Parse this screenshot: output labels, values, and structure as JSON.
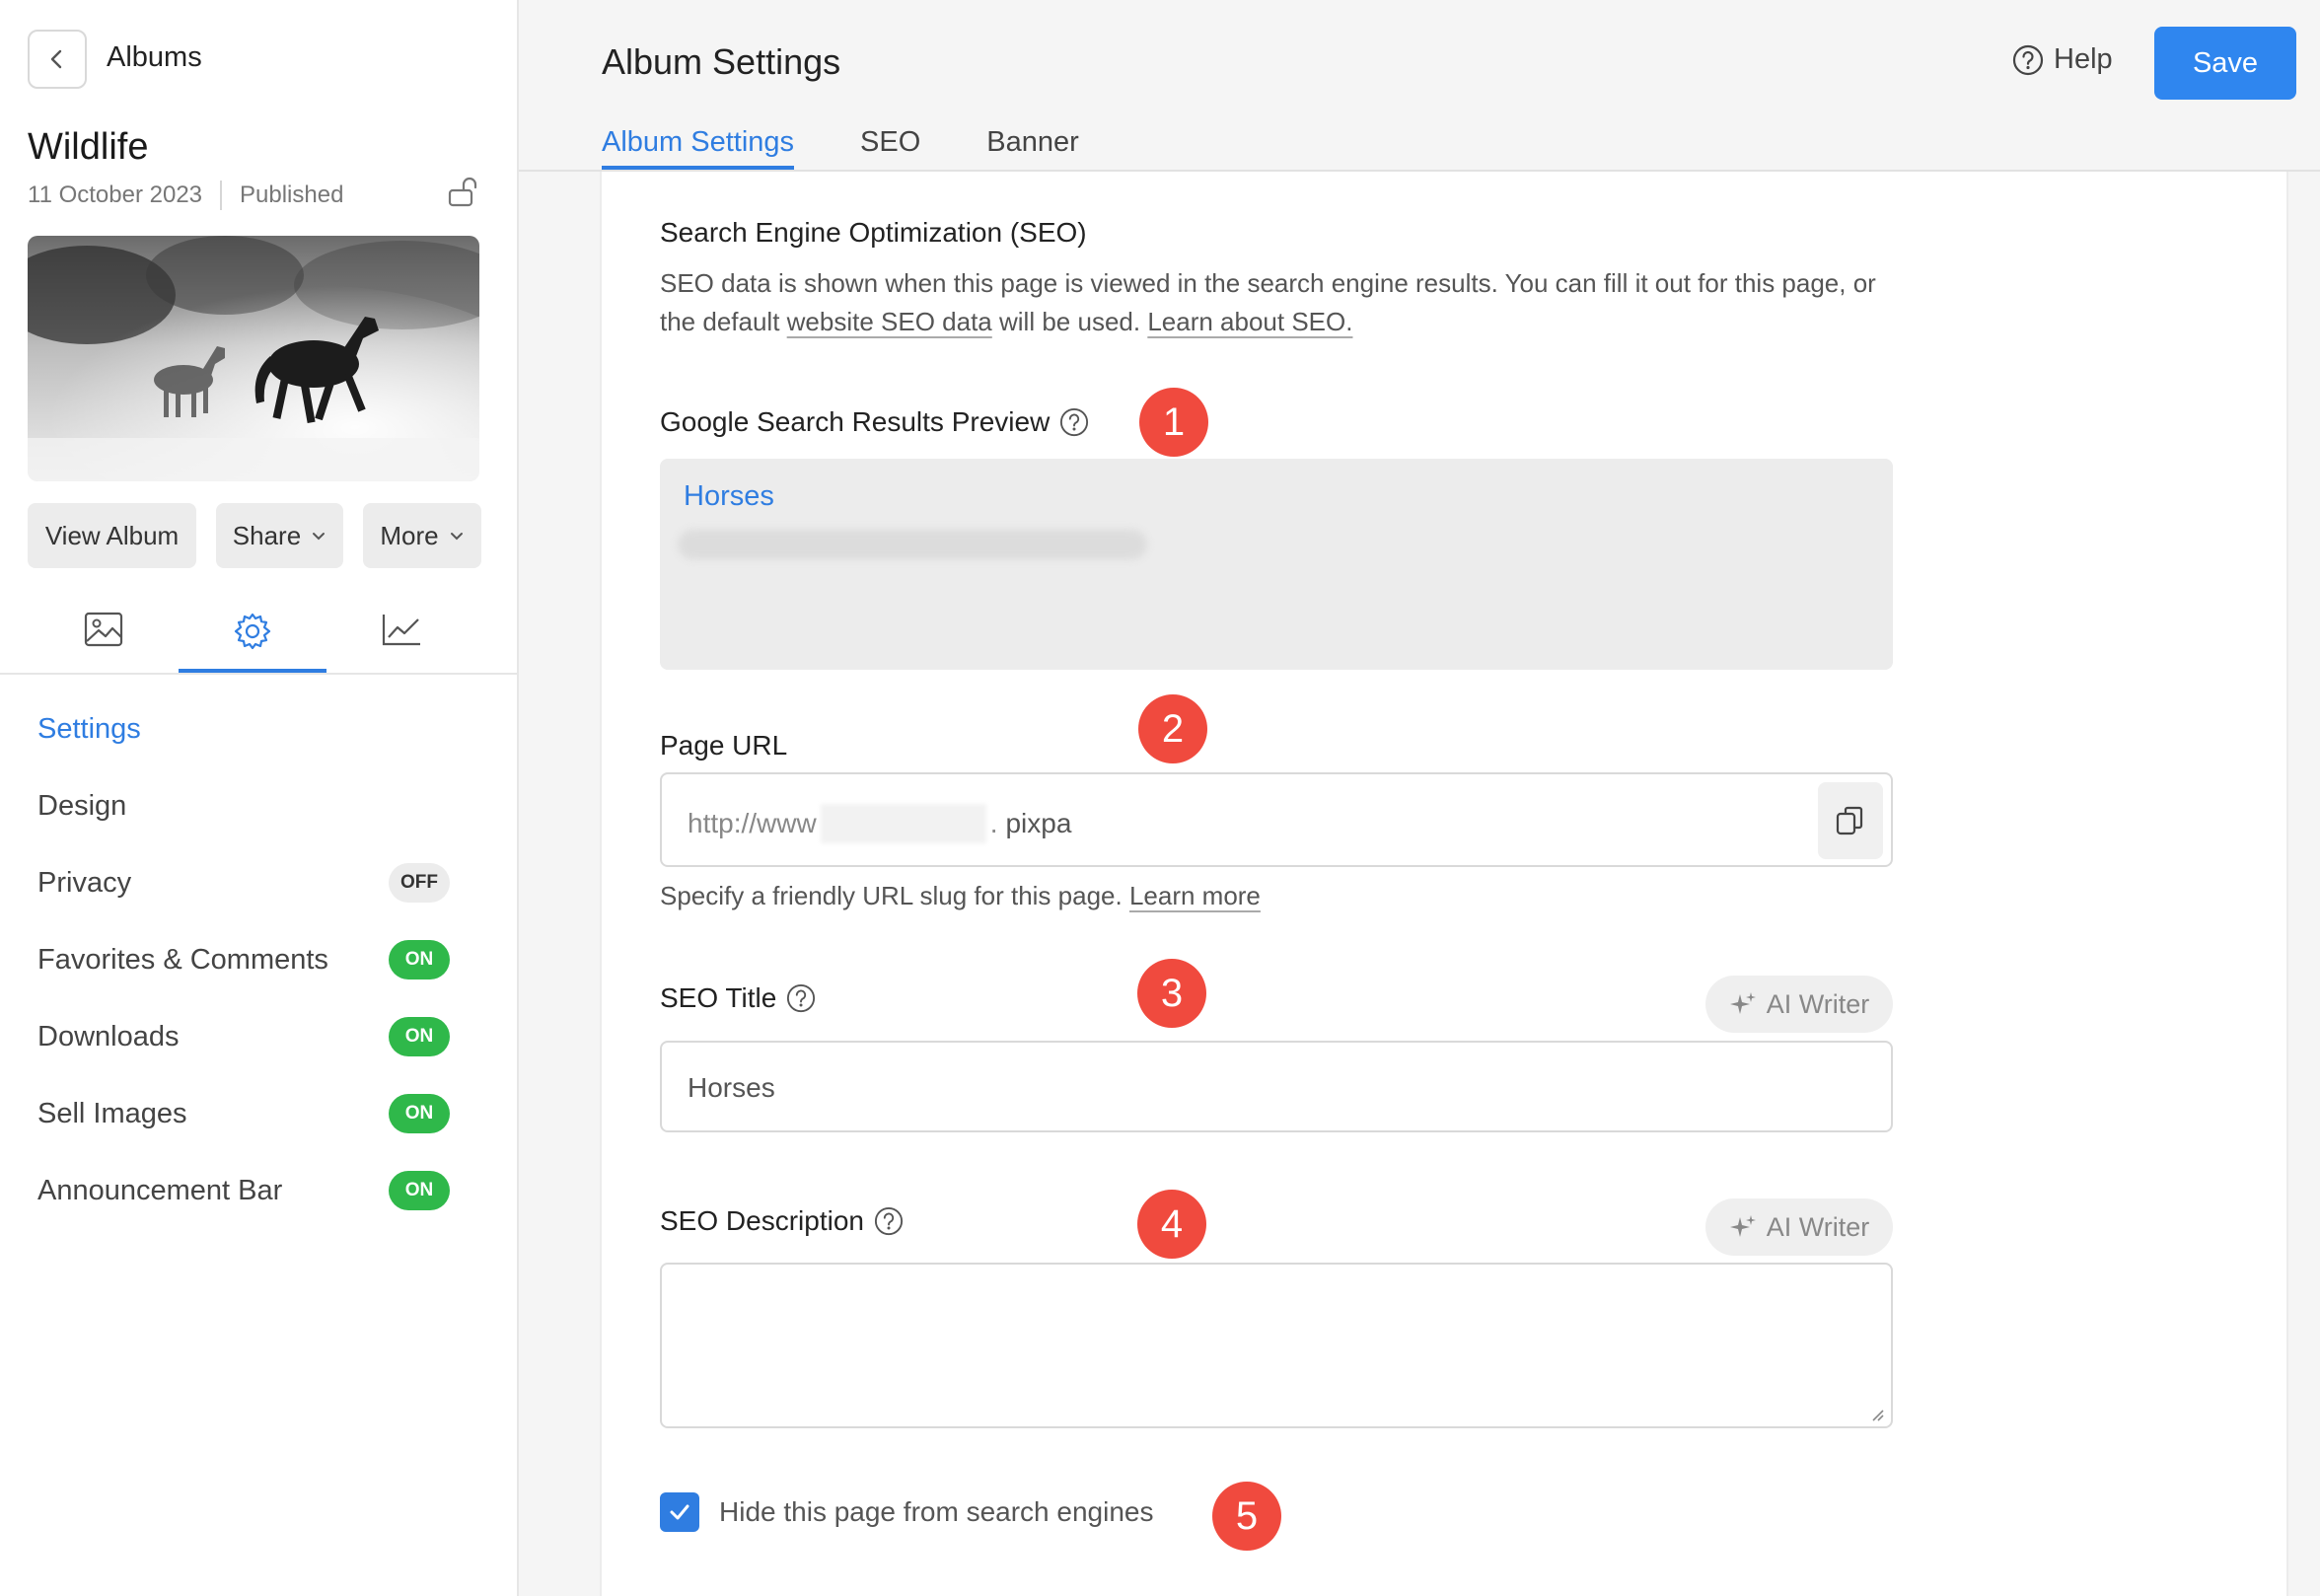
{
  "sidebar": {
    "back_label": "Albums",
    "album_title": "Wildlife",
    "date": "11 October 2023",
    "status": "Published",
    "buttons": {
      "view": "View Album",
      "share": "Share",
      "more": "More"
    },
    "nav": [
      {
        "label": "Settings",
        "toggle": null
      },
      {
        "label": "Design",
        "toggle": null
      },
      {
        "label": "Privacy",
        "toggle": "OFF"
      },
      {
        "label": "Favorites & Comments",
        "toggle": "ON"
      },
      {
        "label": "Downloads",
        "toggle": "ON"
      },
      {
        "label": "Sell Images",
        "toggle": "ON"
      },
      {
        "label": "Announcement Bar",
        "toggle": "ON"
      }
    ]
  },
  "header": {
    "title": "Album Settings",
    "help": "Help",
    "save": "Save",
    "tabs": [
      "Album Settings",
      "SEO",
      "Banner"
    ]
  },
  "seo": {
    "heading": "Search Engine Optimization (SEO)",
    "desc_part1": "SEO data is shown when this page is viewed in the search engine results. You can fill it out for this page, or the default ",
    "desc_link1": "website SEO data",
    "desc_part2": " will be used. ",
    "desc_link2": "Learn about SEO.",
    "preview_label": "Google Search Results Preview",
    "preview_title": "Horses",
    "url_label": "Page URL",
    "url_prefix": "http://www",
    "url_dot": ".",
    "url_domain": "pixpa",
    "url_hint": "Specify a friendly URL slug for this page. ",
    "url_hint_link": "Learn more",
    "title_label": "SEO Title",
    "title_value": "Horses",
    "desc_label": "SEO Description",
    "desc_value": "",
    "ai_writer": "AI Writer",
    "hide_label": "Hide this page from search engines",
    "hide_checked": true
  },
  "badges": [
    "1",
    "2",
    "3",
    "4",
    "5"
  ],
  "colors": {
    "accent": "#2f7de1",
    "save": "#2f86ef",
    "on": "#2fb84a",
    "badge": "#f04a3e"
  }
}
